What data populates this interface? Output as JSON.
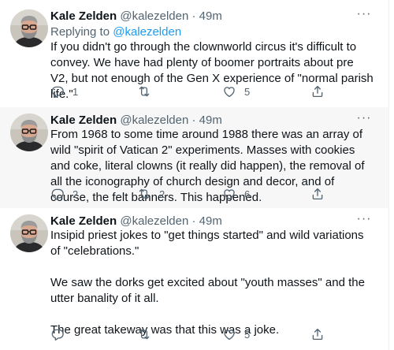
{
  "tweets": [
    {
      "name": "Kale Zelden",
      "handle": "@kalezelden",
      "dot": "·",
      "time": "49m",
      "more": "···",
      "replying_prefix": "Replying to",
      "replying_to": "@kalezelden",
      "paragraphs": [
        "If you didn't go through the clownworld circus it's difficult to convey. We have had plenty of boomer portraits about pre V2, but not enough of the Gen X experience of \"normal parish life.\""
      ],
      "replies": "1",
      "retweets": "",
      "likes": "5"
    },
    {
      "name": "Kale Zelden",
      "handle": "@kalezelden",
      "dot": "·",
      "time": "49m",
      "more": "···",
      "paragraphs": [
        "From 1968 to some time around 1988 there was an array of wild \"spirit of Vatican 2\" experiments. Masses with cookies and coke, literal clowns (it really did happen), the removal of all the iconography of church design and decor, and of course, the felt banners. This happened."
      ],
      "replies": "2",
      "retweets": "2",
      "likes": "6"
    },
    {
      "name": "Kale Zelden",
      "handle": "@kalezelden",
      "dot": "·",
      "time": "49m",
      "more": "···",
      "paragraphs": [
        "Insipid priest jokes to \"get things started\" and wild variations of \"celebrations.\"",
        "We saw the dorks get excited about \"youth masses\" and  the utter banality of it all.",
        "The great takeway was that this was a joke."
      ],
      "replies": "",
      "retweets": "",
      "likes": "5"
    }
  ],
  "icons": {
    "reply": "reply-icon",
    "retweet": "retweet-icon",
    "like": "heart-icon",
    "share": "share-icon",
    "more": "more-icon"
  },
  "colors": {
    "text": "#0f1419",
    "secondary": "#536471",
    "link": "#1d9bf0",
    "highlight_bg": "#f7f7f7",
    "border": "#eff3f4"
  }
}
